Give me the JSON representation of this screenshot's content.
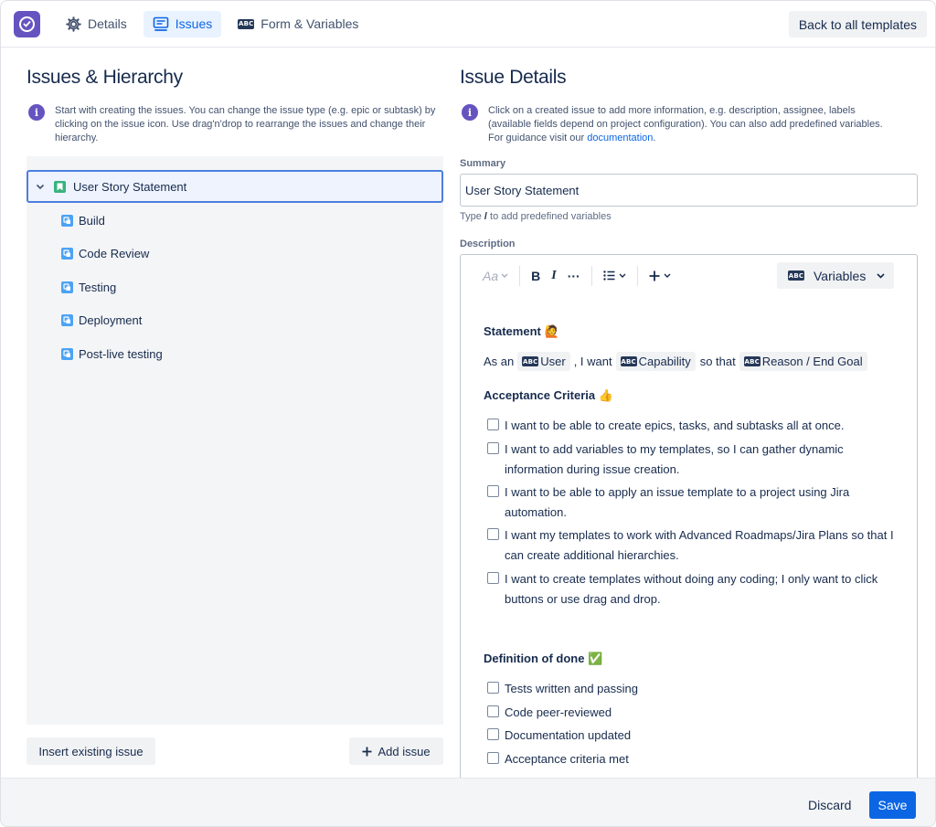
{
  "topbar": {
    "tabs": [
      {
        "label": "Details",
        "icon": "gear-icon"
      },
      {
        "label": "Issues",
        "icon": "monitor-icon",
        "active": true
      },
      {
        "label": "Form & Variables",
        "icon": "abc-icon"
      }
    ],
    "back_label": "Back to all templates",
    "abc_text": "ABC"
  },
  "left": {
    "title": "Issues & Hierarchy",
    "info_icon": "i",
    "info": "Start with creating the issues. You can change the issue type (e.g. epic or subtask) by clicking on the issue icon. Use drag'n'drop to rearrange the issues and change their hierarchy.",
    "root": {
      "label": "User Story Statement",
      "icon": "story-icon"
    },
    "children": [
      {
        "label": "Build",
        "icon": "task-icon"
      },
      {
        "label": "Code Review",
        "icon": "task-icon"
      },
      {
        "label": "Testing",
        "icon": "task-icon"
      },
      {
        "label": "Deployment",
        "icon": "task-icon"
      },
      {
        "label": "Post-live testing",
        "icon": "task-icon"
      }
    ],
    "insert_label": "Insert existing issue",
    "add_label": "Add issue"
  },
  "right": {
    "title": "Issue Details",
    "info_before": "Click on a created issue to add more information, e.g. description, assignee, labels (available fields depend on project configuration). You can also add predefined variables. For guidance visit our ",
    "info_link": "documentation",
    "info_after": ".",
    "summary_label": "Summary",
    "summary_value": "User Story Statement",
    "hint_before": "Type ",
    "hint_key": "/",
    "hint_after": " to add predefined variables",
    "description_label": "Description",
    "toolbar": {
      "text_style": "Aa",
      "bold": "B",
      "italic": "I",
      "more": "···",
      "plus": "+",
      "variables_label": "Variables"
    },
    "statement_heading": "Statement 🙋",
    "statement": {
      "as_an": "As an",
      "user_chip": "User",
      "i_want": ", I want",
      "capability_chip": "Capability",
      "so_that": "so that",
      "reason_chip": "Reason / End Goal"
    },
    "acceptance_heading": "Acceptance Criteria 👍",
    "acceptance_items": [
      "I want to be able to create epics, tasks, and subtasks all at once.",
      "I want to add variables to my templates, so I can gather dynamic information during issue creation.",
      "I want to be able to apply an issue template to a project using Jira automation.",
      "I want my templates to work with Advanced Roadmaps/Jira Plans so that I can create additional hierarchies.",
      "I want to create templates without doing any coding; I only want to click buttons or use drag and drop."
    ],
    "dod_heading": "Definition of done ✅",
    "dod_items": [
      "Tests written and passing",
      "Code peer-reviewed",
      "Documentation updated",
      "Acceptance criteria met"
    ]
  },
  "footer": {
    "discard_label": "Discard",
    "save_label": "Save"
  },
  "colors": {
    "brand": "#6554c0",
    "primary": "#0c66e4",
    "story": "#36b37e",
    "task": "#4ba3f5"
  }
}
